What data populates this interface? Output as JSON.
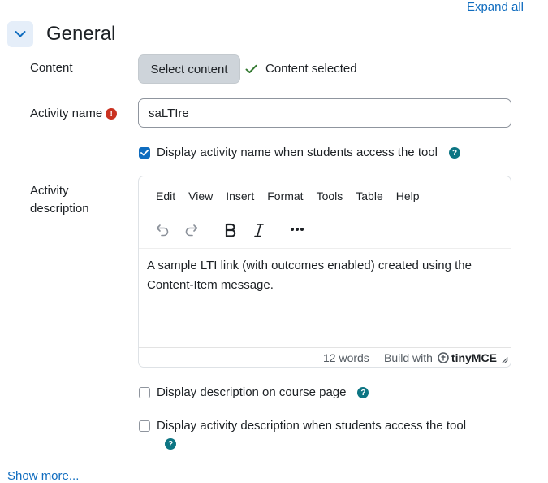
{
  "header": {
    "expand_all": "Expand all",
    "section_title": "General"
  },
  "content_field": {
    "label": "Content",
    "select_button": "Select content",
    "status": "Content selected"
  },
  "activity_name": {
    "label": "Activity name",
    "value": "saLTIre"
  },
  "display_name_checkbox": {
    "label": "Display activity name when students access the tool",
    "checked": true
  },
  "activity_description": {
    "label_line1": "Activity",
    "label_line2": "description",
    "menu": [
      "Edit",
      "View",
      "Insert",
      "Format",
      "Tools",
      "Table",
      "Help"
    ],
    "content": "A sample LTI link (with outcomes enabled) created using the Content-Item message.",
    "word_count": "12 words",
    "build_with": "Build with",
    "brand": "tinyMCE"
  },
  "display_description_checkbox": {
    "label": "Display description on course page",
    "checked": false
  },
  "display_activity_description_checkbox": {
    "label": "Display activity description when students access the tool",
    "checked": false
  },
  "footer": {
    "show_more": "Show more..."
  },
  "colors": {
    "accent": "#0f6cbf",
    "help": "#0d7583",
    "required": "#ca3120",
    "success": "#357a32"
  },
  "icons": [
    "chevron-down-icon",
    "check-icon",
    "required-icon",
    "help-icon",
    "undo-icon",
    "redo-icon",
    "bold-icon",
    "italic-icon",
    "more-icon",
    "resize-icon",
    "tiny-logo-icon"
  ]
}
